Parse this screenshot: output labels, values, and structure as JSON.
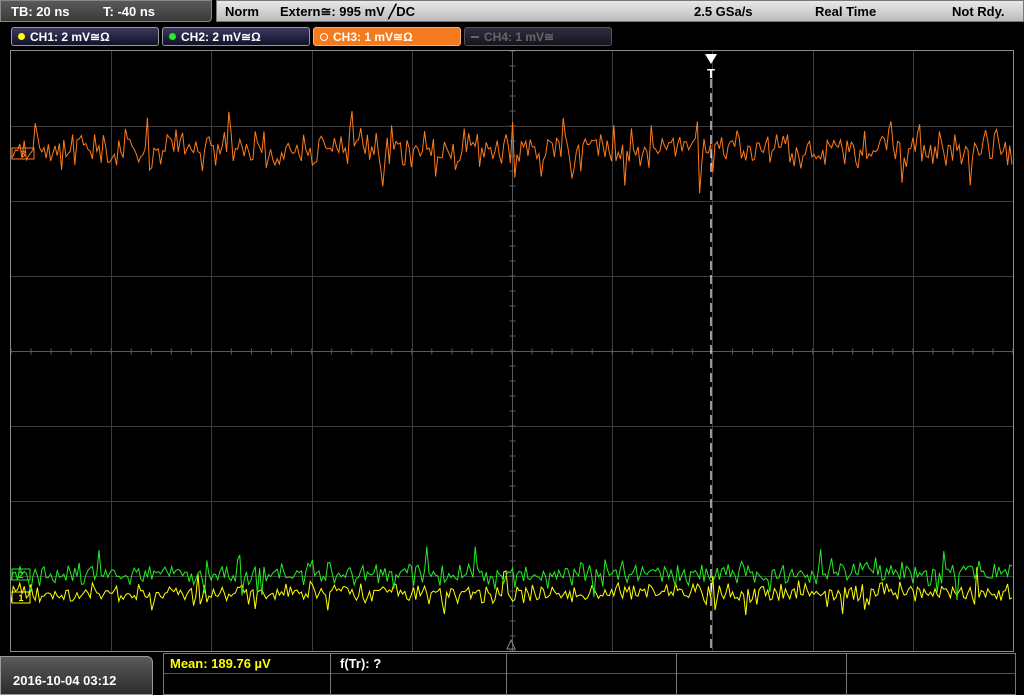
{
  "topbar": {
    "timebase": "TB: 20 ns",
    "trigger_time": "T: -40 ns",
    "mode": "Norm",
    "trigger_source": "Extern≅: 995 mV ╱DC",
    "sample_rate": "2.5 GSa/s",
    "acquisition": "Real Time",
    "status": "Not Rdy."
  },
  "channels": [
    {
      "label": "CH1: 2 mV≅Ω",
      "color": "#ffff00",
      "active": true
    },
    {
      "label": "CH2: 2 mV≅Ω",
      "color": "#22ee22",
      "active": true
    },
    {
      "label": "CH3: 1 mV≅Ω",
      "color": "#ff7a1a",
      "active": true,
      "selected": true
    },
    {
      "label": "CH4: 1 mV≅",
      "color": "#777777",
      "active": false
    }
  ],
  "markers": {
    "ch3": "3",
    "ch2": "2",
    "ch1": "1",
    "trigger": "T"
  },
  "bottom": {
    "datetime": "2016-10-04 03:12",
    "measurements": [
      {
        "text": "Mean: 189.76 µV",
        "color": "#ffff00"
      },
      {
        "text": "f(Tr): ?",
        "color": "#ffffff"
      }
    ]
  },
  "colors": {
    "ch1": "#ffff00",
    "ch2": "#22ee22",
    "ch3": "#ff7a1a",
    "grid": "#3c3c3c",
    "trigger_line": "#ffffff"
  }
}
